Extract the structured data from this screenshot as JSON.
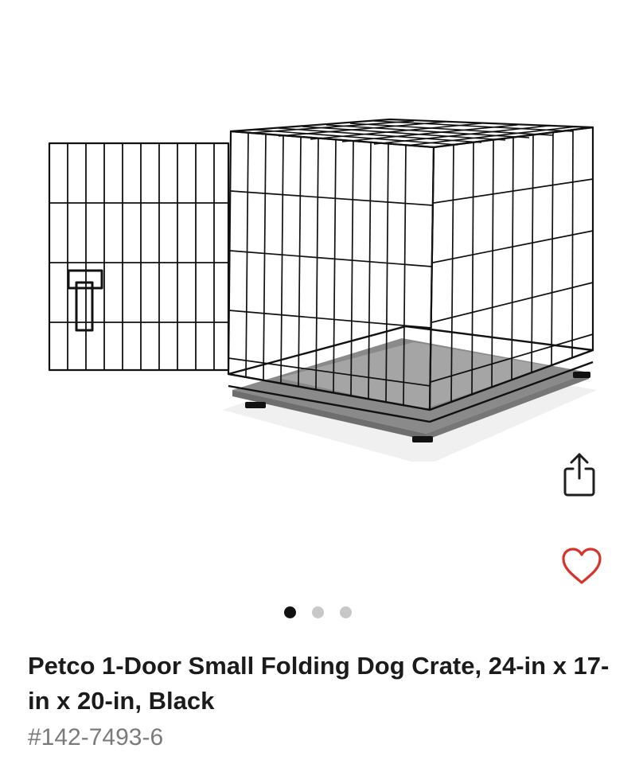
{
  "gallery": {
    "image_alt": "Petco 1-Door Small Folding Dog Crate",
    "dots": [
      {
        "state": "active"
      },
      {
        "state": "inactive"
      },
      {
        "state": "inactive"
      }
    ],
    "current_slide": 1,
    "total_slides": 3
  },
  "actions": {
    "share_icon": "share-icon",
    "favorite_icon": "heart-icon",
    "favorite_color": "#d8332a"
  },
  "product": {
    "title": "Petco 1-Door Small Folding Dog Crate, 24-in x 17-in x 20-in, Black",
    "sku": "#142-7493-6"
  }
}
